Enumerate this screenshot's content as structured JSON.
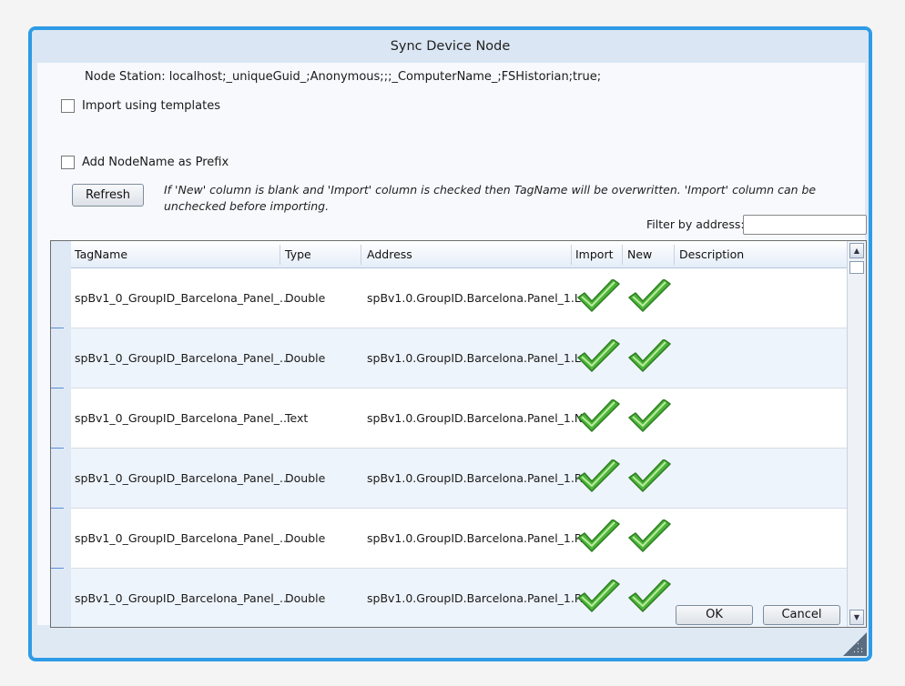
{
  "dialog": {
    "title": "Sync Device Node",
    "node_station": "Node Station: localhost;_uniqueGuid_;Anonymous;;;_ComputerName_;FSHistorian;true;",
    "import_templates_label": "Import using templates",
    "add_prefix_label": "Add NodeName as Prefix",
    "refresh_label": "Refresh",
    "notice": "If 'New' column is blank and 'Import' column is checked then TagName will be overwritten. 'Import' column can be unchecked before importing.",
    "filter_label": "Filter by address:",
    "filter_value": "",
    "ok_label": "OK",
    "cancel_label": "Cancel"
  },
  "grid": {
    "columns": [
      "TagName",
      "Type",
      "Address",
      "Import",
      "New",
      "Description"
    ],
    "rows": [
      {
        "tagname": "spBv1_0_GroupID_Barcelona_Panel_...",
        "type": "Double",
        "address": "spBv1.0.GroupID.Barcelona.Panel_1.L...",
        "import": true,
        "new": true,
        "description": ""
      },
      {
        "tagname": "spBv1_0_GroupID_Barcelona_Panel_...",
        "type": "Double",
        "address": "spBv1.0.GroupID.Barcelona.Panel_1.L...",
        "import": true,
        "new": true,
        "description": ""
      },
      {
        "tagname": "spBv1_0_GroupID_Barcelona_Panel_...",
        "type": "Text",
        "address": "spBv1.0.GroupID.Barcelona.Panel_1.N...",
        "import": true,
        "new": true,
        "description": ""
      },
      {
        "tagname": "spBv1_0_GroupID_Barcelona_Panel_...",
        "type": "Double",
        "address": "spBv1.0.GroupID.Barcelona.Panel_1.P...",
        "import": true,
        "new": true,
        "description": ""
      },
      {
        "tagname": "spBv1_0_GroupID_Barcelona_Panel_...",
        "type": "Double",
        "address": "spBv1.0.GroupID.Barcelona.Panel_1.P...",
        "import": true,
        "new": true,
        "description": ""
      },
      {
        "tagname": "spBv1_0_GroupID_Barcelona_Panel_...",
        "type": "Double",
        "address": "spBv1.0.GroupID.Barcelona.Panel_1.P...",
        "import": true,
        "new": true,
        "description": ""
      }
    ]
  },
  "colors": {
    "frame": "#2e9be6",
    "check_green": "#4cb33a",
    "alt_row": "#eef4fb"
  },
  "icons": {
    "check": "check-icon",
    "scroll_up": "scroll-up-arrow-icon",
    "scroll_down": "scroll-down-arrow-icon",
    "resize_grip": "resize-grip-icon"
  }
}
